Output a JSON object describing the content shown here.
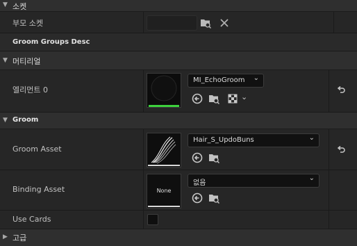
{
  "sections": {
    "socket": {
      "title": "소켓",
      "parent_socket_label": "부모 소켓",
      "parent_socket_value": ""
    },
    "groom_groups_desc": {
      "title": "Groom Groups Desc"
    },
    "material": {
      "title": "머티리얼",
      "element_label": "엘리먼트 0",
      "material_name": "MI_EchoGroom"
    },
    "groom": {
      "title": "Groom",
      "groom_asset_label": "Groom Asset",
      "groom_asset_value": "Hair_S_UpdoBuns",
      "binding_asset_label": "Binding Asset",
      "binding_asset_value": "없음",
      "binding_thumbnail_text": "None",
      "use_cards_label": "Use Cards",
      "use_cards_checked": false
    },
    "advanced": {
      "title": "고급"
    }
  },
  "icons": {
    "expand": "triangle-down-icon",
    "collapse": "triangle-right-icon",
    "browse": "folder-search-icon",
    "clear": "close-icon",
    "use_selected": "arrow-left-circle-icon",
    "reset": "reset-arrow-icon",
    "checker": "checkerboard-icon"
  },
  "colors": {
    "material_bar": "#3cd13c",
    "panel_bg": "#262626",
    "category_bg": "#2f2f2f"
  }
}
